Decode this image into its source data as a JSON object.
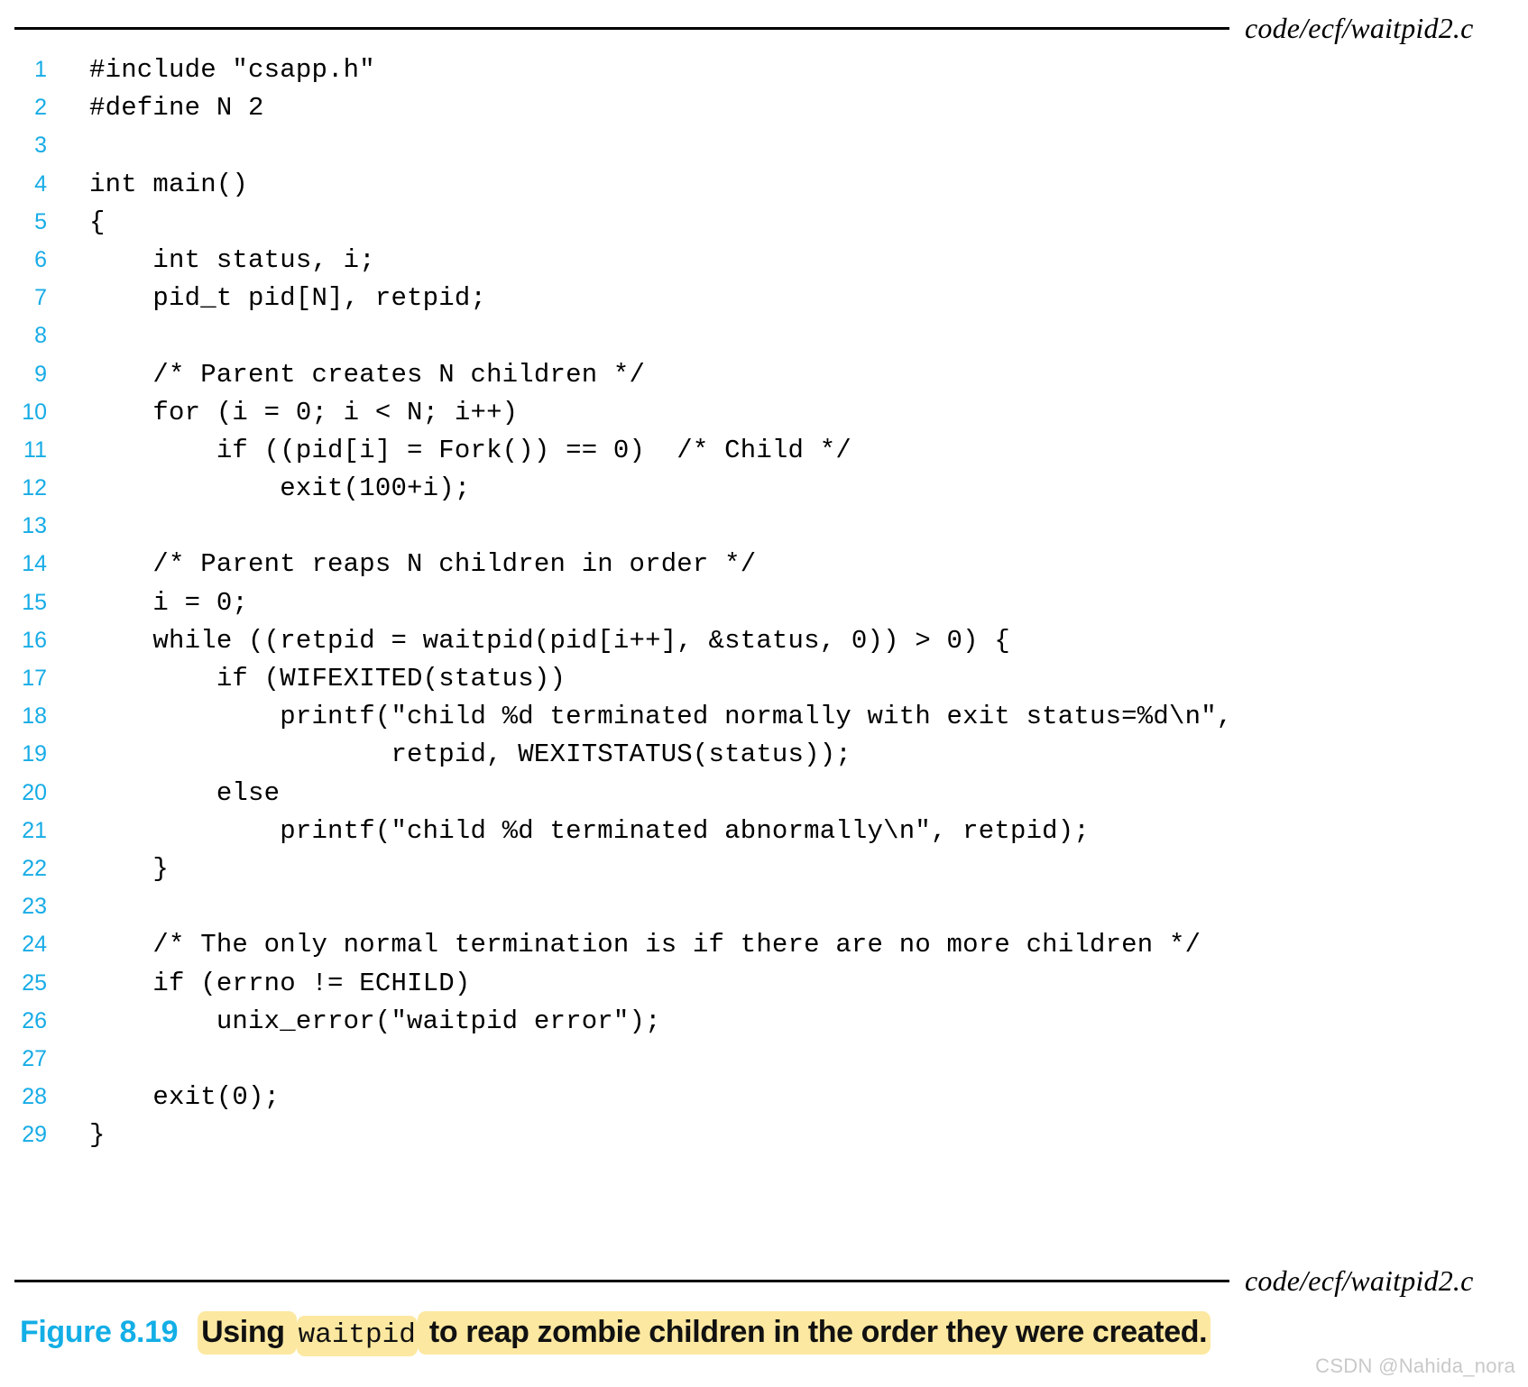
{
  "figure": {
    "header_filename": "code/ecf/waitpid2.c",
    "footer_filename": "code/ecf/waitpid2.c",
    "caption_label": "Figure 8.19",
    "caption_part1": "Using ",
    "caption_code": "waitpid",
    "caption_part2": " to reap zombie children in the order they were created.",
    "watermark": "CSDN @Nahida_nora",
    "colors": {
      "line_number": "#17ACE6",
      "caption_label": "#13AEE6",
      "highlight": "#FCE8A0",
      "rule": "#000000",
      "watermark": "#c9c9c9"
    }
  },
  "code": {
    "language": "c",
    "first_line": 1,
    "last_line": 29,
    "lines": [
      {
        "n": "1",
        "text": "#include \"csapp.h\""
      },
      {
        "n": "2",
        "text": "#define N 2"
      },
      {
        "n": "3",
        "text": ""
      },
      {
        "n": "4",
        "text": "int main()"
      },
      {
        "n": "5",
        "text": "{"
      },
      {
        "n": "6",
        "text": "    int status, i;"
      },
      {
        "n": "7",
        "text": "    pid_t pid[N], retpid;"
      },
      {
        "n": "8",
        "text": ""
      },
      {
        "n": "9",
        "text": "    /* Parent creates N children */"
      },
      {
        "n": "10",
        "text": "    for (i = 0; i < N; i++)"
      },
      {
        "n": "11",
        "text": "        if ((pid[i] = Fork()) == 0)  /* Child */"
      },
      {
        "n": "12",
        "text": "            exit(100+i);"
      },
      {
        "n": "13",
        "text": ""
      },
      {
        "n": "14",
        "text": "    /* Parent reaps N children in order */"
      },
      {
        "n": "15",
        "text": "    i = 0;"
      },
      {
        "n": "16",
        "text": "    while ((retpid = waitpid(pid[i++], &status, 0)) > 0) {"
      },
      {
        "n": "17",
        "text": "        if (WIFEXITED(status))"
      },
      {
        "n": "18",
        "text": "            printf(\"child %d terminated normally with exit status=%d\\n\","
      },
      {
        "n": "19",
        "text": "                   retpid, WEXITSTATUS(status));"
      },
      {
        "n": "20",
        "text": "        else"
      },
      {
        "n": "21",
        "text": "            printf(\"child %d terminated abnormally\\n\", retpid);"
      },
      {
        "n": "22",
        "text": "    }"
      },
      {
        "n": "23",
        "text": ""
      },
      {
        "n": "24",
        "text": "    /* The only normal termination is if there are no more children */"
      },
      {
        "n": "25",
        "text": "    if (errno != ECHILD)"
      },
      {
        "n": "26",
        "text": "        unix_error(\"waitpid error\");"
      },
      {
        "n": "27",
        "text": ""
      },
      {
        "n": "28",
        "text": "    exit(0);"
      },
      {
        "n": "29",
        "text": "}"
      }
    ]
  }
}
